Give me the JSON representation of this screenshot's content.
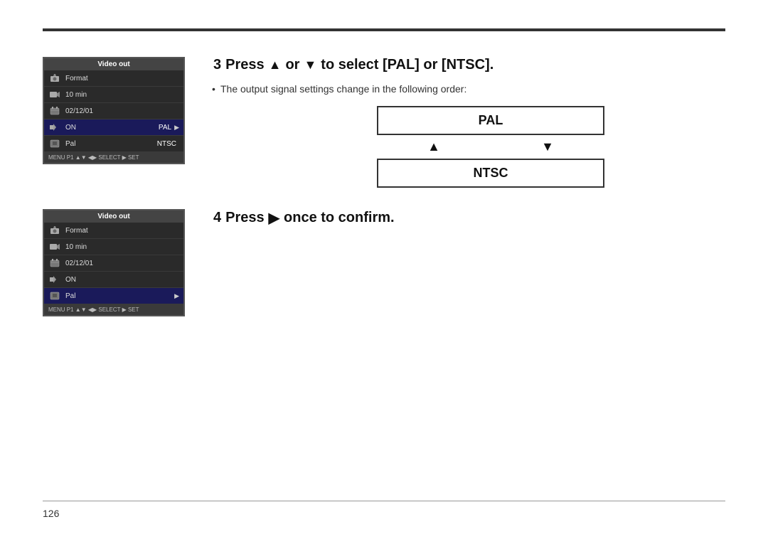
{
  "page": {
    "number": "126",
    "top_border_visible": true
  },
  "step3": {
    "number": "3",
    "heading_prefix": "Press",
    "up_arrow": "▲",
    "or_text": "or",
    "down_arrow": "▼",
    "heading_suffix": "to select  [PAL] or [NTSC].",
    "bullet": "The output signal settings change in the following order:"
  },
  "diagram": {
    "pal_label": "PAL",
    "ntsc_label": "NTSC",
    "arrow_up": "▲",
    "arrow_down": "▼"
  },
  "step4": {
    "number": "4",
    "heading_prefix": "Press",
    "right_arrow": "▶",
    "heading_suffix": "once to confirm."
  },
  "screen1": {
    "header": "Video out",
    "rows": [
      {
        "icon": "📷",
        "label": "Format",
        "value": "",
        "arrow": ""
      },
      {
        "icon": "🎥",
        "label": "10 min",
        "value": "",
        "arrow": ""
      },
      {
        "icon": "📅",
        "label": "02/12/01",
        "value": "",
        "arrow": ""
      },
      {
        "icon": "🔊",
        "label": "ON",
        "value": "PAL",
        "arrow": "▶",
        "highlight": true
      },
      {
        "icon": "📺",
        "label": "Pal",
        "value": "NTSC",
        "arrow": "",
        "highlight": false
      }
    ],
    "footer": "MENU P1  ▲▼  ◀▶ SELECT  ▶ SET"
  },
  "screen2": {
    "header": "Video out",
    "rows": [
      {
        "icon": "📷",
        "label": "Format",
        "value": "",
        "arrow": ""
      },
      {
        "icon": "🎥",
        "label": "10 min",
        "value": "",
        "arrow": ""
      },
      {
        "icon": "📅",
        "label": "02/12/01",
        "value": "",
        "arrow": ""
      },
      {
        "icon": "🔊",
        "label": "ON",
        "value": "",
        "arrow": ""
      },
      {
        "icon": "📺",
        "label": "Pal",
        "value": "",
        "arrow": "▶",
        "highlight": true
      }
    ],
    "footer": "MENU P1  ▲▼  ◀▶ SELECT  ▶ SET"
  }
}
